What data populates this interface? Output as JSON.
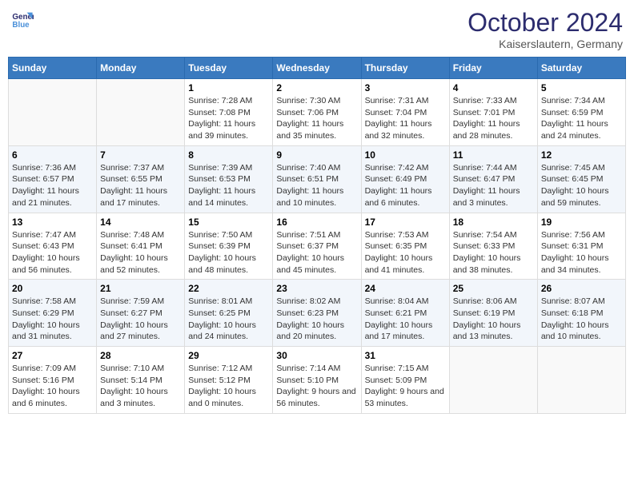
{
  "header": {
    "logo_line1": "General",
    "logo_line2": "Blue",
    "title": "October 2024",
    "subtitle": "Kaiserslautern, Germany"
  },
  "weekdays": [
    "Sunday",
    "Monday",
    "Tuesday",
    "Wednesday",
    "Thursday",
    "Friday",
    "Saturday"
  ],
  "weeks": [
    [
      {
        "day": "",
        "info": ""
      },
      {
        "day": "",
        "info": ""
      },
      {
        "day": "1",
        "info": "Sunrise: 7:28 AM\nSunset: 7:08 PM\nDaylight: 11 hours and 39 minutes."
      },
      {
        "day": "2",
        "info": "Sunrise: 7:30 AM\nSunset: 7:06 PM\nDaylight: 11 hours and 35 minutes."
      },
      {
        "day": "3",
        "info": "Sunrise: 7:31 AM\nSunset: 7:04 PM\nDaylight: 11 hours and 32 minutes."
      },
      {
        "day": "4",
        "info": "Sunrise: 7:33 AM\nSunset: 7:01 PM\nDaylight: 11 hours and 28 minutes."
      },
      {
        "day": "5",
        "info": "Sunrise: 7:34 AM\nSunset: 6:59 PM\nDaylight: 11 hours and 24 minutes."
      }
    ],
    [
      {
        "day": "6",
        "info": "Sunrise: 7:36 AM\nSunset: 6:57 PM\nDaylight: 11 hours and 21 minutes."
      },
      {
        "day": "7",
        "info": "Sunrise: 7:37 AM\nSunset: 6:55 PM\nDaylight: 11 hours and 17 minutes."
      },
      {
        "day": "8",
        "info": "Sunrise: 7:39 AM\nSunset: 6:53 PM\nDaylight: 11 hours and 14 minutes."
      },
      {
        "day": "9",
        "info": "Sunrise: 7:40 AM\nSunset: 6:51 PM\nDaylight: 11 hours and 10 minutes."
      },
      {
        "day": "10",
        "info": "Sunrise: 7:42 AM\nSunset: 6:49 PM\nDaylight: 11 hours and 6 minutes."
      },
      {
        "day": "11",
        "info": "Sunrise: 7:44 AM\nSunset: 6:47 PM\nDaylight: 11 hours and 3 minutes."
      },
      {
        "day": "12",
        "info": "Sunrise: 7:45 AM\nSunset: 6:45 PM\nDaylight: 10 hours and 59 minutes."
      }
    ],
    [
      {
        "day": "13",
        "info": "Sunrise: 7:47 AM\nSunset: 6:43 PM\nDaylight: 10 hours and 56 minutes."
      },
      {
        "day": "14",
        "info": "Sunrise: 7:48 AM\nSunset: 6:41 PM\nDaylight: 10 hours and 52 minutes."
      },
      {
        "day": "15",
        "info": "Sunrise: 7:50 AM\nSunset: 6:39 PM\nDaylight: 10 hours and 48 minutes."
      },
      {
        "day": "16",
        "info": "Sunrise: 7:51 AM\nSunset: 6:37 PM\nDaylight: 10 hours and 45 minutes."
      },
      {
        "day": "17",
        "info": "Sunrise: 7:53 AM\nSunset: 6:35 PM\nDaylight: 10 hours and 41 minutes."
      },
      {
        "day": "18",
        "info": "Sunrise: 7:54 AM\nSunset: 6:33 PM\nDaylight: 10 hours and 38 minutes."
      },
      {
        "day": "19",
        "info": "Sunrise: 7:56 AM\nSunset: 6:31 PM\nDaylight: 10 hours and 34 minutes."
      }
    ],
    [
      {
        "day": "20",
        "info": "Sunrise: 7:58 AM\nSunset: 6:29 PM\nDaylight: 10 hours and 31 minutes."
      },
      {
        "day": "21",
        "info": "Sunrise: 7:59 AM\nSunset: 6:27 PM\nDaylight: 10 hours and 27 minutes."
      },
      {
        "day": "22",
        "info": "Sunrise: 8:01 AM\nSunset: 6:25 PM\nDaylight: 10 hours and 24 minutes."
      },
      {
        "day": "23",
        "info": "Sunrise: 8:02 AM\nSunset: 6:23 PM\nDaylight: 10 hours and 20 minutes."
      },
      {
        "day": "24",
        "info": "Sunrise: 8:04 AM\nSunset: 6:21 PM\nDaylight: 10 hours and 17 minutes."
      },
      {
        "day": "25",
        "info": "Sunrise: 8:06 AM\nSunset: 6:19 PM\nDaylight: 10 hours and 13 minutes."
      },
      {
        "day": "26",
        "info": "Sunrise: 8:07 AM\nSunset: 6:18 PM\nDaylight: 10 hours and 10 minutes."
      }
    ],
    [
      {
        "day": "27",
        "info": "Sunrise: 7:09 AM\nSunset: 5:16 PM\nDaylight: 10 hours and 6 minutes."
      },
      {
        "day": "28",
        "info": "Sunrise: 7:10 AM\nSunset: 5:14 PM\nDaylight: 10 hours and 3 minutes."
      },
      {
        "day": "29",
        "info": "Sunrise: 7:12 AM\nSunset: 5:12 PM\nDaylight: 10 hours and 0 minutes."
      },
      {
        "day": "30",
        "info": "Sunrise: 7:14 AM\nSunset: 5:10 PM\nDaylight: 9 hours and 56 minutes."
      },
      {
        "day": "31",
        "info": "Sunrise: 7:15 AM\nSunset: 5:09 PM\nDaylight: 9 hours and 53 minutes."
      },
      {
        "day": "",
        "info": ""
      },
      {
        "day": "",
        "info": ""
      }
    ]
  ]
}
